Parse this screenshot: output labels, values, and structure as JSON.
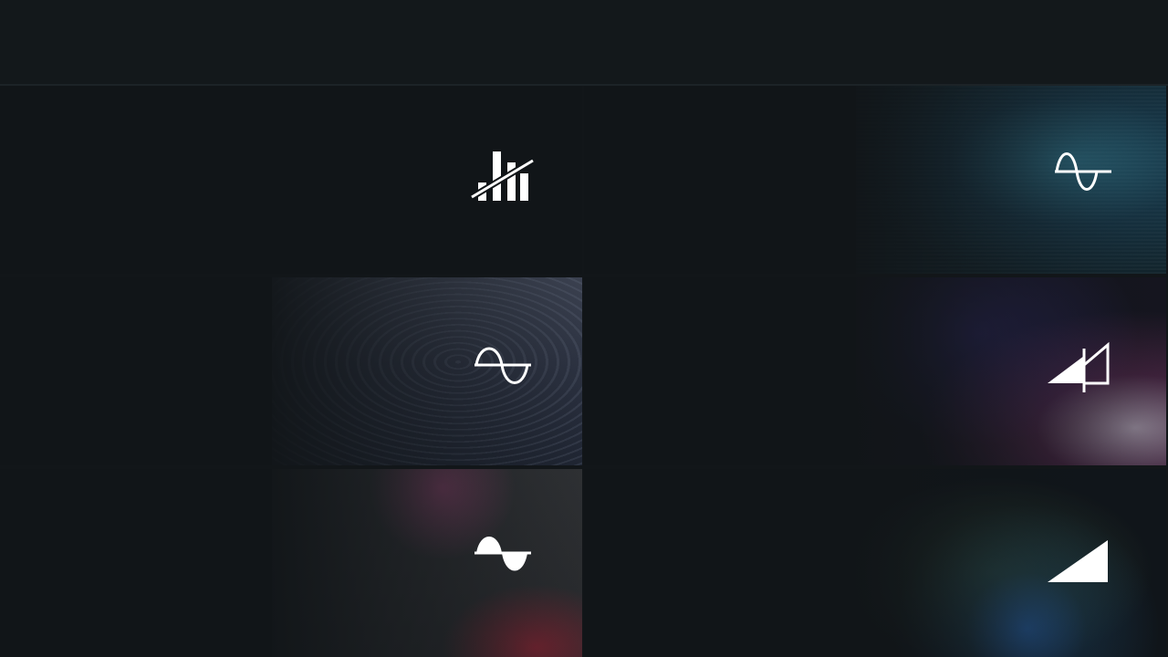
{
  "tiles": [
    {
      "icon": "eq-bars-off-icon"
    },
    {
      "icon": "wave-single-bump-icon"
    },
    {
      "icon": "sine-wave-icon"
    },
    {
      "icon": "gate-ramp-icon"
    },
    {
      "icon": "filled-sine-icon"
    },
    {
      "icon": "ramp-triangle-icon"
    }
  ]
}
